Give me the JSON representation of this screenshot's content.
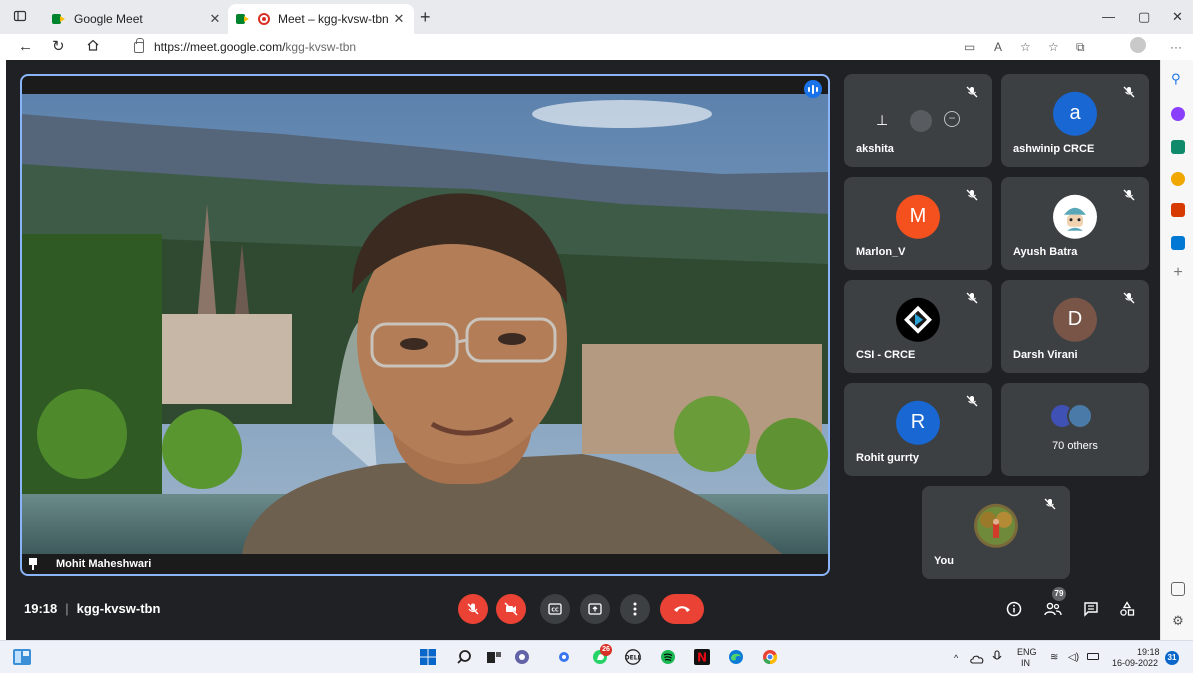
{
  "browser": {
    "tabs": [
      {
        "title": "Google Meet"
      },
      {
        "title": "Meet – kgg-kvsw-tbn"
      }
    ],
    "url_host": "https://meet.google.com/",
    "url_path": "kgg-kvsw-tbn"
  },
  "meeting": {
    "time": "19:18",
    "code": "kgg-kvsw-tbn",
    "presenter": "Mohit Maheshwari",
    "participant_count": "79"
  },
  "participants": [
    {
      "name": "akshita",
      "initial": "",
      "color": "#3c4043"
    },
    {
      "name": "ashwinip CRCE",
      "initial": "a",
      "color": "#1967d2"
    },
    {
      "name": "Marlon_V",
      "initial": "M",
      "color": "#f4511e"
    },
    {
      "name": "Ayush Batra",
      "initial": "",
      "color": "#ffffff"
    },
    {
      "name": "CSI - CRCE",
      "initial": "",
      "color": "#000000"
    },
    {
      "name": "Darsh Virani",
      "initial": "D",
      "color": "#795548"
    },
    {
      "name": "Rohit gurrty",
      "initial": "R",
      "color": "#1967d2"
    }
  ],
  "others": {
    "label": "70 others"
  },
  "self": {
    "name": "You"
  },
  "colors": {
    "meet_bg": "#202124",
    "tile_bg": "#3c4043",
    "active_border": "#8ab4f8",
    "red": "#ea4335"
  },
  "taskbar": {
    "lang": "ENG",
    "region": "IN",
    "time": "19:18",
    "date": "16-09-2022",
    "whatsapp_badge": "26",
    "notification_count": "31"
  }
}
